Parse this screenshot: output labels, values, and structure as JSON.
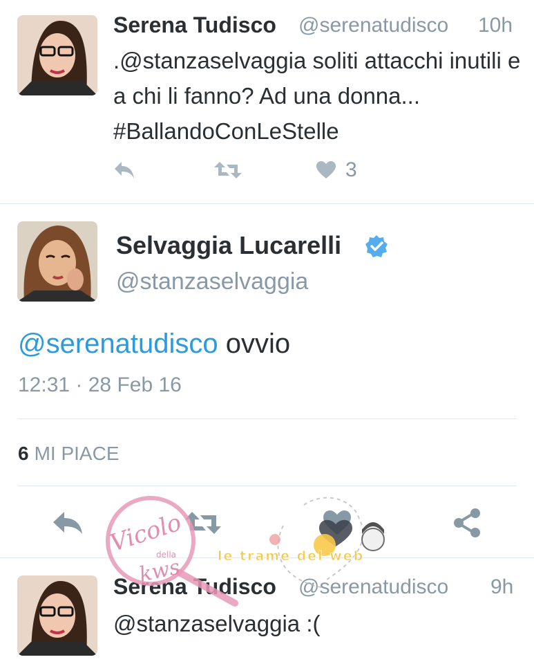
{
  "tweet1": {
    "name": "Serena Tudisco",
    "handle": "@serenatudisco",
    "time": "10h",
    "text": ".@stanzaselvaggia soliti attacchi inutili e a chi li fanno? Ad una donna... #BallandoConLeStelle",
    "like_count": "3",
    "icons": [
      "reply-icon",
      "retweet-icon",
      "heart-icon"
    ]
  },
  "main_tweet": {
    "name": "Selvaggia Lucarelli",
    "handle": "@stanzaselvaggia",
    "mention": "@serenatudisco",
    "text": " ovvio",
    "date": "12:31 · 28 Feb 16",
    "likes_count": "6",
    "likes_label": "MI PIACE",
    "icons": [
      "reply-icon",
      "retweet-icon",
      "like-icon",
      "share-icon"
    ]
  },
  "tweet3": {
    "name": "Serena Tudisco",
    "handle": "@serenatudisco",
    "time": "9h",
    "text": "@stanzaselvaggia :("
  },
  "watermark": {
    "script": "Vicolo",
    "small": "della",
    "script2": "kws",
    "banner": "le trame del web"
  },
  "colors": {
    "link": "#2b9be0",
    "muted": "#8899a6",
    "icon": "#aab8c2",
    "divider": "#e1e8ed",
    "verified": "#55acee"
  }
}
